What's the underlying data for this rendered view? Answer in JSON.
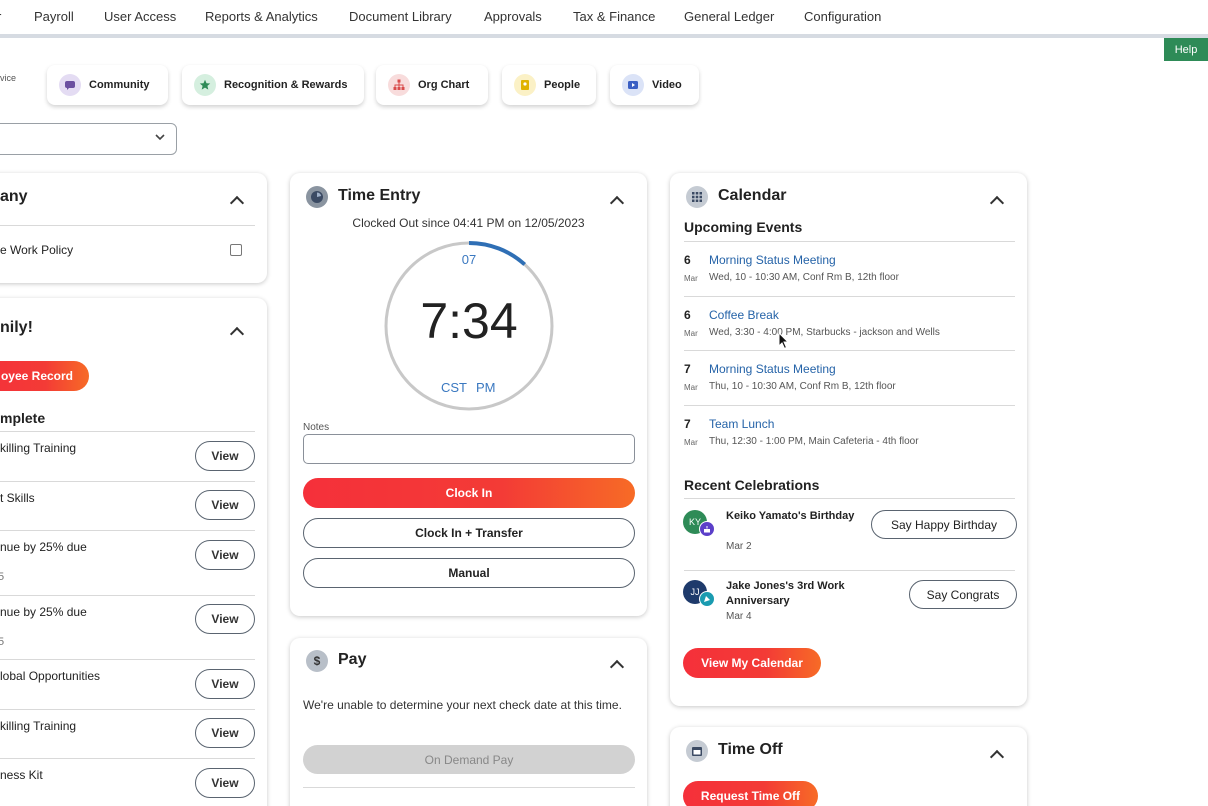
{
  "topnav": {
    "cut_item": "r",
    "items": [
      "Payroll",
      "User Access",
      "Reports & Analytics",
      "Document Library",
      "Approvals",
      "Tax & Finance",
      "General Ledger",
      "Configuration"
    ],
    "help_label": "Help"
  },
  "quicklinks": {
    "cut_label": "vice",
    "tiles": [
      {
        "label": "Community",
        "icon": "community-icon",
        "color": "#6b4fa0"
      },
      {
        "label": "Recognition & Rewards",
        "icon": "star-icon",
        "color": "#2e8b57"
      },
      {
        "label": "Org Chart",
        "icon": "org-chart-icon",
        "color": "#d94b4b"
      },
      {
        "label": "People",
        "icon": "people-icon",
        "color": "#e0b300"
      },
      {
        "label": "Video",
        "icon": "video-icon",
        "color": "#3a5fc4"
      }
    ]
  },
  "company_card": {
    "title": "any",
    "item": "e Work Policy"
  },
  "family_card": {
    "title": "nily!",
    "record_button": "oyee Record",
    "section": "mplete",
    "view_label": "View",
    "tasks": [
      {
        "label": "killing Training",
        "sub": ""
      },
      {
        "label": "t Skills",
        "sub": ""
      },
      {
        "label": "nue by 25% due",
        "sub": "5"
      },
      {
        "label": "nue by 25% due",
        "sub": "5"
      },
      {
        "label": "lobal Opportunities",
        "sub": ""
      },
      {
        "label": "killing Training",
        "sub": ""
      },
      {
        "label": "ness Kit",
        "sub": ""
      }
    ]
  },
  "time_entry": {
    "title": "Time Entry",
    "status": "Clocked Out since 04:41 PM on 12/05/2023",
    "seconds": "07",
    "time": "7:34",
    "timezone": "CST",
    "ampm": "PM",
    "notes_label": "Notes",
    "notes_value": "",
    "clock_in": "Clock In",
    "clock_in_transfer": "Clock In + Transfer",
    "manual": "Manual",
    "seconds_progress": 0.117
  },
  "pay_card": {
    "title": "Pay",
    "message": "We're unable to determine your next check date at this time.",
    "on_demand": "On Demand Pay"
  },
  "calendar": {
    "title": "Calendar",
    "upcoming_heading": "Upcoming Events",
    "events": [
      {
        "day": "6",
        "month": "Mar",
        "title": "Morning Status Meeting",
        "details": "Wed, 10 - 10:30 AM, Conf Rm B, 12th floor"
      },
      {
        "day": "6",
        "month": "Mar",
        "title": "Coffee Break",
        "details": "Wed, 3:30 - 4:00 PM, Starbucks - jackson and Wells"
      },
      {
        "day": "7",
        "month": "Mar",
        "title": "Morning Status Meeting",
        "details": "Thu, 10 - 10:30 AM, Conf Rm B, 12th floor"
      },
      {
        "day": "7",
        "month": "Mar",
        "title": "Team Lunch",
        "details": "Thu, 12:30 - 1:00 PM, Main Cafeteria - 4th floor"
      }
    ],
    "celebrations_heading": "Recent Celebrations",
    "celebrations": [
      {
        "initials": "KY",
        "name": "Keiko Yamato's Birthday",
        "date": "Mar 2",
        "action": "Say Happy Birthday",
        "avatar_color": "#2e8b57",
        "badge_color": "#5b3fc9"
      },
      {
        "initials": "JJ",
        "name": "Jake Jones's 3rd Work Anniversary",
        "date": "Mar 4",
        "action": "Say Congrats",
        "avatar_color": "#1e3a6b",
        "badge_color": "#1a9bb0"
      }
    ],
    "view_calendar": "View My Calendar"
  },
  "time_off": {
    "title": "Time Off",
    "request_button": "Request Time Off"
  }
}
